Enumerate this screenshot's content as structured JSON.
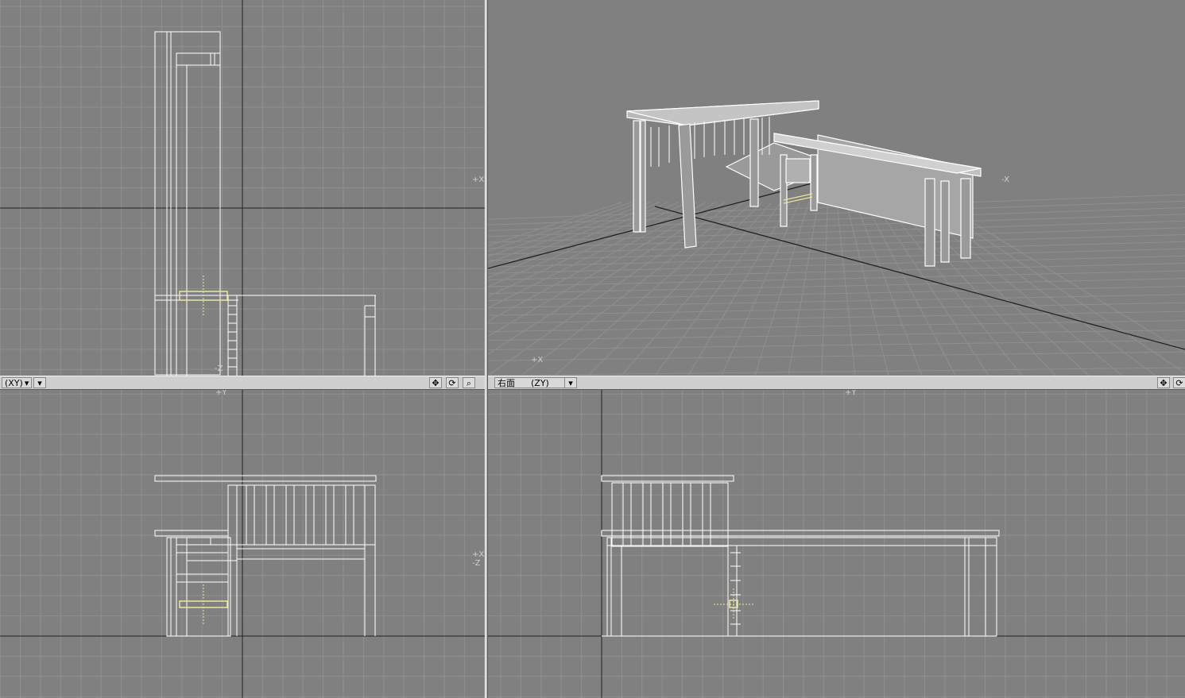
{
  "viewports": {
    "top_left": {
      "labels": {
        "x": "+X",
        "z": "-Z"
      }
    },
    "top_right": {
      "labels": {
        "neg_x": "-X",
        "pos_x": "+X"
      }
    },
    "bottom_left": {
      "view_label": "(XY)",
      "labels": {
        "y": "+Y",
        "xz": "+X -Z"
      }
    },
    "bottom_right": {
      "view_name": "右面",
      "view_label": "(ZY)",
      "labels": {
        "y": "+Y"
      }
    }
  },
  "icons": {
    "move": "move-icon",
    "rotate": "rotate-icon",
    "zoom": "zoom-icon",
    "dropdown": "chevron-down-icon"
  },
  "colors": {
    "background": "#808080",
    "grid": "#8c8c8c",
    "axis": "#2a2a2a",
    "wire": "#ffffff",
    "selected": "#e8e8a0"
  }
}
